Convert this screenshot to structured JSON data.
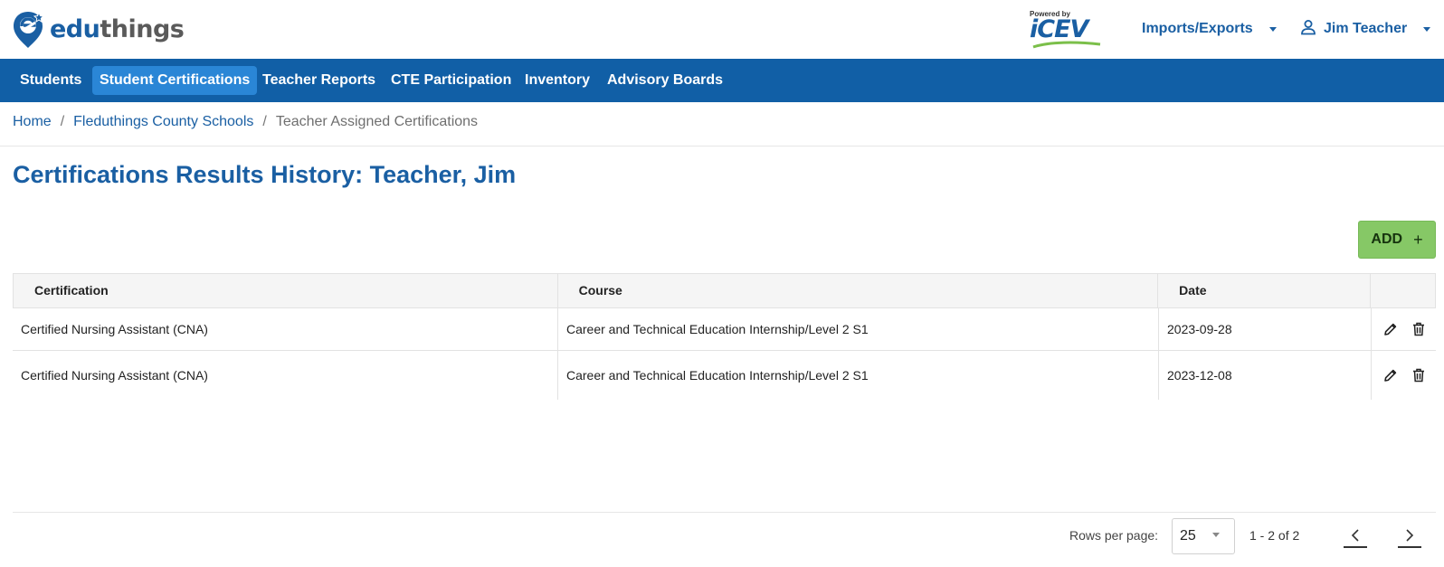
{
  "header": {
    "logo_text_1": "edu",
    "logo_text_2": "things",
    "powered_by": "Powered by",
    "partner_logo": "iCEV",
    "imports_exports": "Imports/Exports",
    "user_name": "Jim Teacher"
  },
  "nav": {
    "items": [
      {
        "label": "Students"
      },
      {
        "label": "Student Certifications"
      },
      {
        "label": "Teacher Reports"
      },
      {
        "label": "CTE Participation"
      },
      {
        "label": "Inventory"
      },
      {
        "label": "Advisory Boards"
      }
    ],
    "active_index": 1
  },
  "breadcrumb": {
    "home": "Home",
    "district": "Fleduthings County Schools",
    "current": "Teacher Assigned Certifications",
    "separator": "/"
  },
  "page": {
    "title": "Certifications Results History: Teacher, Jim"
  },
  "add_button": {
    "label": "ADD",
    "icon": "plus-icon"
  },
  "table": {
    "columns": [
      "Certification",
      "Course",
      "Date",
      ""
    ],
    "rows": [
      {
        "certification": "Certified Nursing Assistant (CNA)",
        "course": "Career and Technical Education Internship/Level 2 S1",
        "date": "2023-09-28"
      },
      {
        "certification": "Certified Nursing Assistant (CNA)",
        "course": "Career and Technical Education Internship/Level 2 S1",
        "date": "2023-12-08"
      }
    ],
    "row_actions": [
      "pencil-icon",
      "trash-icon"
    ]
  },
  "pagination": {
    "rows_per_page_label": "Rows per page:",
    "rows_per_page_value": "25",
    "range": "1 - 2 of 2"
  },
  "colors": {
    "brand_blue": "#115fa6",
    "active_nav": "#2a86d6",
    "title_blue": "#1a5fa3",
    "add_green": "#86c866"
  }
}
